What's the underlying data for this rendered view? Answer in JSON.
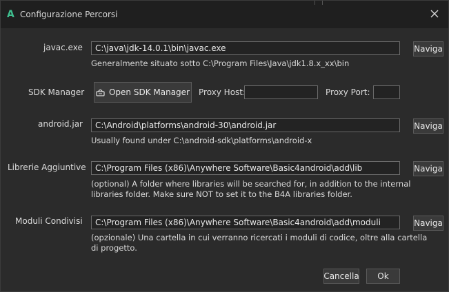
{
  "window": {
    "title": "Configurazione Percorsi",
    "app_letter": "A"
  },
  "javac": {
    "label": "javac.exe",
    "value": "C:\\java\\jdk-14.0.1\\bin\\javac.exe",
    "hint": "Generalmente situato sotto C:\\Program Files\\Java\\jdk1.8.x_xx\\bin",
    "browse": "Naviga"
  },
  "sdk": {
    "label": "SDK Manager",
    "button": "Open SDK Manager",
    "proxy_host_label": "Proxy Host:",
    "proxy_host_value": "",
    "proxy_port_label": "Proxy Port:",
    "proxy_port_value": ""
  },
  "android_jar": {
    "label": "android.jar",
    "value": "C:\\Android\\platforms\\android-30\\android.jar",
    "hint": "Usually found under C:\\android-sdk\\platforms\\android-x",
    "browse": "Naviga"
  },
  "libraries": {
    "label": "Librerie Aggiuntive",
    "value": "C:\\Program Files (x86)\\Anywhere Software\\Basic4android\\add\\lib",
    "hint_line1": "(optional) A folder where libraries will be searched for, in addition to the internal",
    "hint_line2": "libraries folder. Make sure NOT to set it to the B4A libraries folder.",
    "browse": "Naviga"
  },
  "modules": {
    "label": "Moduli Condivisi",
    "value": "C:\\Program Files (x86)\\Anywhere Software\\Basic4android\\add\\moduli",
    "hint_line1": "(opzionale) Una cartella in cui verranno ricercati i moduli di codice, oltre alla cartella",
    "hint_line2": "di progetto.",
    "browse": "Naviga"
  },
  "footer": {
    "cancel": "Cancella",
    "ok": "Ok"
  },
  "colors": {
    "accent": "#3fbf8f",
    "background": "#2b2b2b",
    "titlebar": "#1f1f1f"
  }
}
